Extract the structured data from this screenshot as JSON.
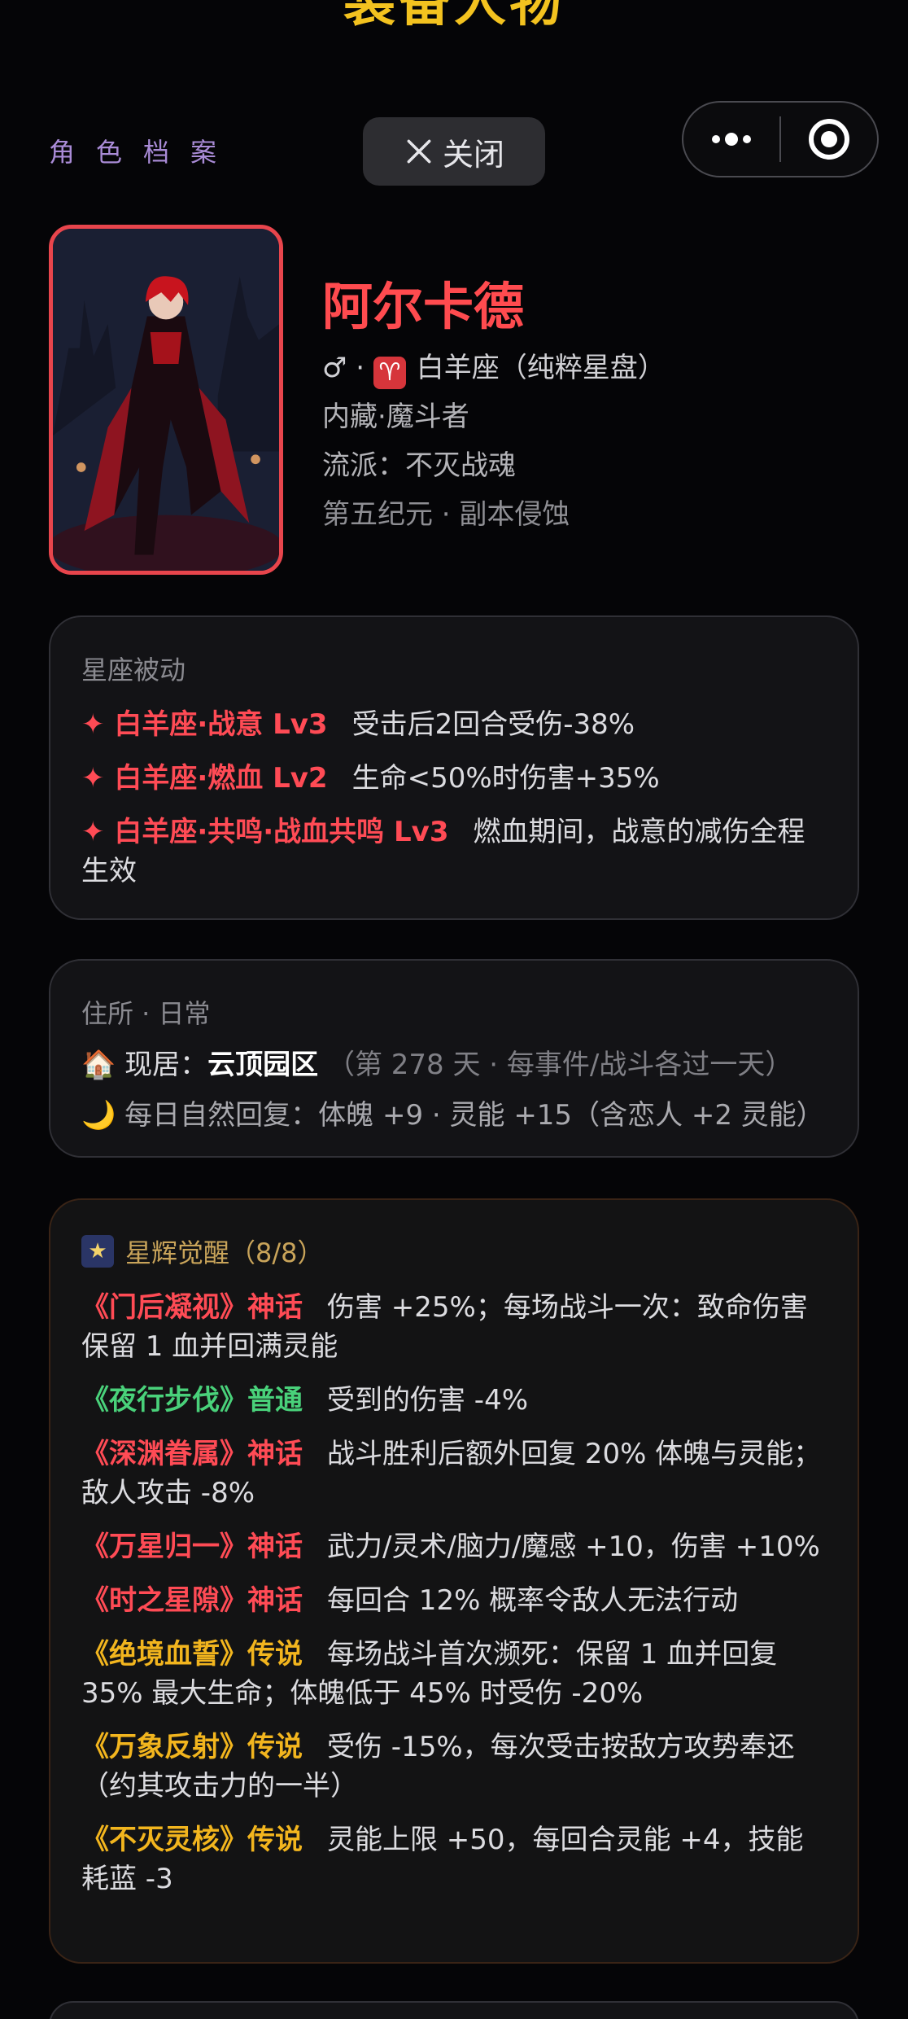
{
  "header": {
    "top_title": "装备人物",
    "section_label": "角色档案",
    "close_label": "关闭"
  },
  "character": {
    "name": "阿尔卡德",
    "gender_symbol": "♂",
    "zodiac_icon": "♈",
    "zodiac_text": "白羊座（纯粹星盘）",
    "hidden": "内藏·魔斗者",
    "school": "流派：不灭战魂",
    "era": "第五纪元 · 副本侵蚀"
  },
  "passive": {
    "title": "星座被动",
    "items": [
      {
        "name": "✦ 白羊座·战意 Lv3",
        "desc": "受击后2回合受伤-38%"
      },
      {
        "name": "✦ 白羊座·燃血 Lv2",
        "desc": "生命<50%时伤害+35%"
      },
      {
        "name": "✦ 白羊座·共鸣·战血共鸣 Lv3",
        "desc": "燃血期间，战意的减伤全程生效"
      }
    ]
  },
  "residence": {
    "title": "住所 · 日常",
    "house_icon": "🏠",
    "label": "现居：",
    "place": "云顶园区",
    "note": "（第 278 天 · 每事件/战斗各过一天）",
    "moon_icon": "🌙",
    "recovery": "每日自然回复：体魄 +9 · 灵能 +15（含恋人 +2 灵能）"
  },
  "awakening": {
    "title": "星辉觉醒（8/8）",
    "items": [
      {
        "name": "《门后凝视》神话",
        "tier": "red",
        "desc": "伤害 +25%；每场战斗一次：致命伤害保留 1 血并回满灵能"
      },
      {
        "name": "《夜行步伐》普通",
        "tier": "green",
        "desc": "受到的伤害 -4%"
      },
      {
        "name": "《深渊眷属》神话",
        "tier": "red",
        "desc": "战斗胜利后额外回复 20% 体魄与灵能；敌人攻击 -8%"
      },
      {
        "name": "《万星归一》神话",
        "tier": "red",
        "desc": "武力/灵术/脑力/魔感 +10，伤害 +10%"
      },
      {
        "name": "《时之星隙》神话",
        "tier": "red",
        "desc": "每回合 12% 概率令敌人无法行动"
      },
      {
        "name": "《绝境血誓》传说",
        "tier": "gold",
        "desc": "每场战斗首次濒死：保留 1 血并回复 35% 最大生命；体魄低于 45% 时受伤 -20%"
      },
      {
        "name": "《万象反射》传说",
        "tier": "gold",
        "desc": "受伤 -15%，每次受击按敌方攻势奉还（约其攻击力的一半）"
      },
      {
        "name": "《不灭灵核》传说",
        "tier": "gold",
        "desc": "灵能上限 +50，每回合灵能 +4，技能耗蓝 -3"
      }
    ]
  },
  "colors": {
    "accent_red": "#ff4b55",
    "accent_green": "#49d17a",
    "accent_gold": "#f2b51e",
    "label_purple": "#a98bd6"
  }
}
